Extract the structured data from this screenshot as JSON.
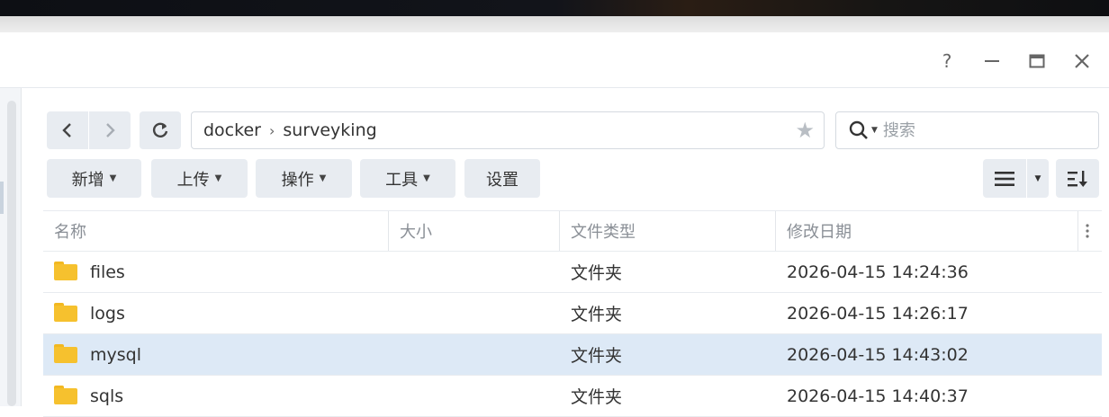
{
  "window": {
    "help_label": "?",
    "minimize_label": "–",
    "maximize_label": "▭",
    "close_label": "✕"
  },
  "nav": {
    "back_icon": "chevron-left",
    "forward_icon": "chevron-right",
    "refresh_icon": "refresh"
  },
  "breadcrumb": {
    "segments": [
      "docker",
      "surveyking"
    ],
    "separator": "›"
  },
  "search": {
    "placeholder": "搜索"
  },
  "toolbar": {
    "create_label": "新增",
    "upload_label": "上传",
    "action_label": "操作",
    "tools_label": "工具",
    "settings_label": "设置"
  },
  "table": {
    "columns": [
      "名称",
      "大小",
      "文件类型",
      "修改日期"
    ],
    "rows": [
      {
        "name": "files",
        "size": "",
        "type": "文件夹",
        "modified": "2026-04-15 14:24:36",
        "selected": false
      },
      {
        "name": "logs",
        "size": "",
        "type": "文件夹",
        "modified": "2026-04-15 14:26:17",
        "selected": false
      },
      {
        "name": "mysql",
        "size": "",
        "type": "文件夹",
        "modified": "2026-04-15 14:43:02",
        "selected": true
      },
      {
        "name": "sqls",
        "size": "",
        "type": "文件夹",
        "modified": "2026-04-15 14:40:37",
        "selected": false
      }
    ]
  },
  "colors": {
    "accent": "#dde9f6",
    "button_bg": "#e8ecf1",
    "folder": "#f6c12e"
  }
}
